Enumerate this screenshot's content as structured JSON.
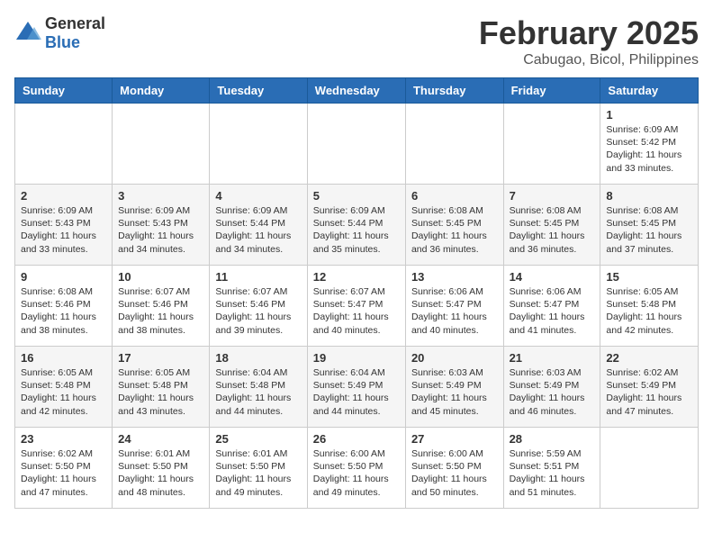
{
  "logo": {
    "general": "General",
    "blue": "Blue"
  },
  "header": {
    "month": "February 2025",
    "location": "Cabugao, Bicol, Philippines"
  },
  "days_of_week": [
    "Sunday",
    "Monday",
    "Tuesday",
    "Wednesday",
    "Thursday",
    "Friday",
    "Saturday"
  ],
  "weeks": [
    [
      {
        "day": "",
        "info": ""
      },
      {
        "day": "",
        "info": ""
      },
      {
        "day": "",
        "info": ""
      },
      {
        "day": "",
        "info": ""
      },
      {
        "day": "",
        "info": ""
      },
      {
        "day": "",
        "info": ""
      },
      {
        "day": "1",
        "info": "Sunrise: 6:09 AM\nSunset: 5:42 PM\nDaylight: 11 hours and 33 minutes."
      }
    ],
    [
      {
        "day": "2",
        "info": "Sunrise: 6:09 AM\nSunset: 5:43 PM\nDaylight: 11 hours and 33 minutes."
      },
      {
        "day": "3",
        "info": "Sunrise: 6:09 AM\nSunset: 5:43 PM\nDaylight: 11 hours and 34 minutes."
      },
      {
        "day": "4",
        "info": "Sunrise: 6:09 AM\nSunset: 5:44 PM\nDaylight: 11 hours and 34 minutes."
      },
      {
        "day": "5",
        "info": "Sunrise: 6:09 AM\nSunset: 5:44 PM\nDaylight: 11 hours and 35 minutes."
      },
      {
        "day": "6",
        "info": "Sunrise: 6:08 AM\nSunset: 5:45 PM\nDaylight: 11 hours and 36 minutes."
      },
      {
        "day": "7",
        "info": "Sunrise: 6:08 AM\nSunset: 5:45 PM\nDaylight: 11 hours and 36 minutes."
      },
      {
        "day": "8",
        "info": "Sunrise: 6:08 AM\nSunset: 5:45 PM\nDaylight: 11 hours and 37 minutes."
      }
    ],
    [
      {
        "day": "9",
        "info": "Sunrise: 6:08 AM\nSunset: 5:46 PM\nDaylight: 11 hours and 38 minutes."
      },
      {
        "day": "10",
        "info": "Sunrise: 6:07 AM\nSunset: 5:46 PM\nDaylight: 11 hours and 38 minutes."
      },
      {
        "day": "11",
        "info": "Sunrise: 6:07 AM\nSunset: 5:46 PM\nDaylight: 11 hours and 39 minutes."
      },
      {
        "day": "12",
        "info": "Sunrise: 6:07 AM\nSunset: 5:47 PM\nDaylight: 11 hours and 40 minutes."
      },
      {
        "day": "13",
        "info": "Sunrise: 6:06 AM\nSunset: 5:47 PM\nDaylight: 11 hours and 40 minutes."
      },
      {
        "day": "14",
        "info": "Sunrise: 6:06 AM\nSunset: 5:47 PM\nDaylight: 11 hours and 41 minutes."
      },
      {
        "day": "15",
        "info": "Sunrise: 6:05 AM\nSunset: 5:48 PM\nDaylight: 11 hours and 42 minutes."
      }
    ],
    [
      {
        "day": "16",
        "info": "Sunrise: 6:05 AM\nSunset: 5:48 PM\nDaylight: 11 hours and 42 minutes."
      },
      {
        "day": "17",
        "info": "Sunrise: 6:05 AM\nSunset: 5:48 PM\nDaylight: 11 hours and 43 minutes."
      },
      {
        "day": "18",
        "info": "Sunrise: 6:04 AM\nSunset: 5:48 PM\nDaylight: 11 hours and 44 minutes."
      },
      {
        "day": "19",
        "info": "Sunrise: 6:04 AM\nSunset: 5:49 PM\nDaylight: 11 hours and 44 minutes."
      },
      {
        "day": "20",
        "info": "Sunrise: 6:03 AM\nSunset: 5:49 PM\nDaylight: 11 hours and 45 minutes."
      },
      {
        "day": "21",
        "info": "Sunrise: 6:03 AM\nSunset: 5:49 PM\nDaylight: 11 hours and 46 minutes."
      },
      {
        "day": "22",
        "info": "Sunrise: 6:02 AM\nSunset: 5:49 PM\nDaylight: 11 hours and 47 minutes."
      }
    ],
    [
      {
        "day": "23",
        "info": "Sunrise: 6:02 AM\nSunset: 5:50 PM\nDaylight: 11 hours and 47 minutes."
      },
      {
        "day": "24",
        "info": "Sunrise: 6:01 AM\nSunset: 5:50 PM\nDaylight: 11 hours and 48 minutes."
      },
      {
        "day": "25",
        "info": "Sunrise: 6:01 AM\nSunset: 5:50 PM\nDaylight: 11 hours and 49 minutes."
      },
      {
        "day": "26",
        "info": "Sunrise: 6:00 AM\nSunset: 5:50 PM\nDaylight: 11 hours and 49 minutes."
      },
      {
        "day": "27",
        "info": "Sunrise: 6:00 AM\nSunset: 5:50 PM\nDaylight: 11 hours and 50 minutes."
      },
      {
        "day": "28",
        "info": "Sunrise: 5:59 AM\nSunset: 5:51 PM\nDaylight: 11 hours and 51 minutes."
      },
      {
        "day": "",
        "info": ""
      }
    ]
  ]
}
